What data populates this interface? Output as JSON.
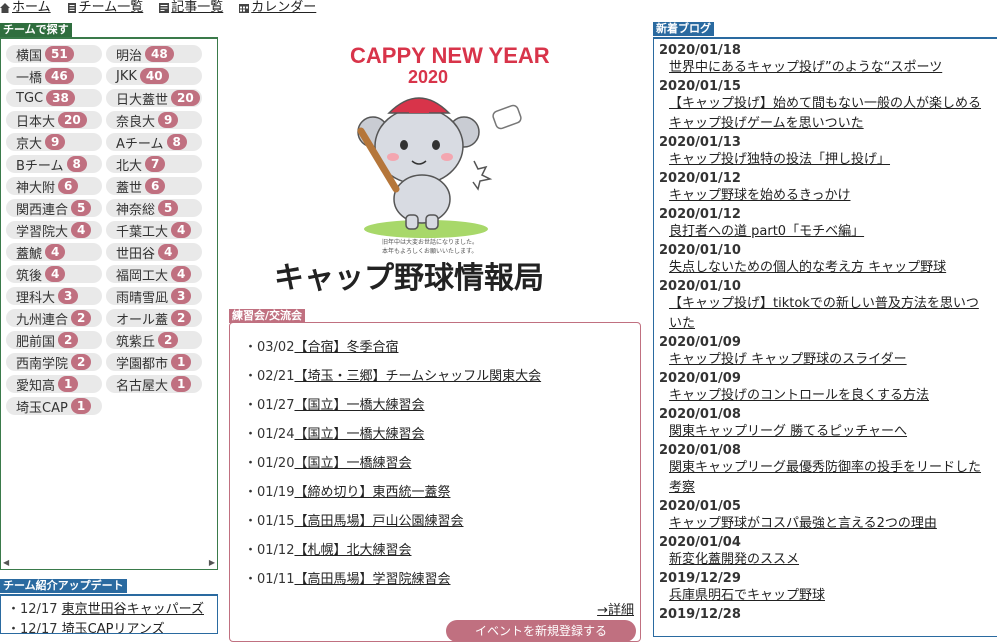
{
  "nav": [
    {
      "label": "ホーム",
      "icon": "home-icon"
    },
    {
      "label": "チーム一覧",
      "icon": "list-icon"
    },
    {
      "label": "記事一覧",
      "icon": "article-icon"
    },
    {
      "label": "カレンダー",
      "icon": "calendar-icon"
    }
  ],
  "team_section": {
    "title": "チームで探す",
    "teams": [
      {
        "name": "横国",
        "count": "51"
      },
      {
        "name": "明治",
        "count": "48"
      },
      {
        "name": "一橋",
        "count": "46"
      },
      {
        "name": "JKK",
        "count": "40"
      },
      {
        "name": "TGC",
        "count": "38"
      },
      {
        "name": "日大蓋世",
        "count": "20"
      },
      {
        "name": "日本大",
        "count": "20"
      },
      {
        "name": "奈良大",
        "count": "9"
      },
      {
        "name": "京大",
        "count": "9"
      },
      {
        "name": "Aチーム",
        "count": "8"
      },
      {
        "name": "Bチーム",
        "count": "8"
      },
      {
        "name": "北大",
        "count": "7"
      },
      {
        "name": "神大附",
        "count": "6"
      },
      {
        "name": "蓋世",
        "count": "6"
      },
      {
        "name": "関西連合",
        "count": "5"
      },
      {
        "name": "神奈総",
        "count": "5"
      },
      {
        "name": "学習院大",
        "count": "4"
      },
      {
        "name": "千葉工大",
        "count": "4"
      },
      {
        "name": "蓋鯱",
        "count": "4"
      },
      {
        "name": "世田谷",
        "count": "4"
      },
      {
        "name": "筑後",
        "count": "4"
      },
      {
        "name": "福岡工大",
        "count": "4"
      },
      {
        "name": "理科大",
        "count": "3"
      },
      {
        "name": "雨晴雪凪",
        "count": "3"
      },
      {
        "name": "九州連合",
        "count": "2"
      },
      {
        "name": "オール蓋",
        "count": "2"
      },
      {
        "name": "肥前国",
        "count": "2"
      },
      {
        "name": "筑紫丘",
        "count": "2"
      },
      {
        "name": "西南学院",
        "count": "2"
      },
      {
        "name": "学園都市",
        "count": "1"
      },
      {
        "name": "愛知高",
        "count": "1"
      },
      {
        "name": "名古屋大",
        "count": "1"
      },
      {
        "name": "埼玉CAP",
        "count": "1"
      }
    ]
  },
  "team_update": {
    "title": "チーム紹介アップデート",
    "items": [
      {
        "date": "12/17",
        "name": "東京世田谷キャッパーズ"
      },
      {
        "date": "12/17",
        "name": "埼玉CAPリアンズ"
      }
    ]
  },
  "banner": {
    "greeting": "CAPPY NEW YEAR",
    "year": "2020",
    "message_line1": "旧年中は大変お世話になりました。",
    "message_line2": "本年もよろしくお願いいたします。",
    "logo": "キャップ野球情報局"
  },
  "practice": {
    "title": "練習会/交流会",
    "items": [
      {
        "date": "03/02",
        "title": "【合宿】冬季合宿"
      },
      {
        "date": "02/21",
        "title": "【埼玉・三郷】チームシャッフル関東大会"
      },
      {
        "date": "01/27",
        "title": "【国立】一橋大練習会"
      },
      {
        "date": "01/24",
        "title": "【国立】一橋大練習会"
      },
      {
        "date": "01/20",
        "title": "【国立】一橋練習会"
      },
      {
        "date": "01/19",
        "title": "【締め切り】東西統一蓋祭"
      },
      {
        "date": "01/15",
        "title": "【高田馬場】戸山公園練習会"
      },
      {
        "date": "01/12",
        "title": "【札幌】北大練習会"
      },
      {
        "date": "01/11",
        "title": "【高田馬場】学習院練習会"
      }
    ],
    "detail_link": "→詳細",
    "button_label": "イベントを新規登録する"
  },
  "blog": {
    "title": "新着ブログ",
    "entries": [
      {
        "date": "2020/01/18",
        "title": "世界中にあるキャップ投げ”のような“スポーツ"
      },
      {
        "date": "2020/01/15",
        "title": "【キャップ投げ】始めて間もない一般の人が楽しめる",
        "title2": "キャップ投げゲームを思いついた"
      },
      {
        "date": "2020/01/13",
        "title": "キャップ投げ独特の投法「押し投げ」"
      },
      {
        "date": "2020/01/12",
        "title": "キャップ野球を始めるきっかけ"
      },
      {
        "date": "2020/01/12",
        "title": "良打者への道 part0「モチベ編」"
      },
      {
        "date": "2020/01/10",
        "title": "失点しないための個人的な考え方 キャップ野球"
      },
      {
        "date": "2020/01/10",
        "title": "【キャップ投げ】tiktokでの新しい普及方法を思いつ",
        "title2": "いた"
      },
      {
        "date": "2020/01/09",
        "title": "キャップ投げ キャップ野球のスライダー"
      },
      {
        "date": "2020/01/09",
        "title": "キャップ投げのコントロールを良くする方法"
      },
      {
        "date": "2020/01/08",
        "title": "関東キャップリーグ 勝てるピッチャーへ"
      },
      {
        "date": "2020/01/08",
        "title": "関東キャップリーグ最優秀防御率の投手をリードした",
        "title2": "考察"
      },
      {
        "date": "2020/01/05",
        "title": "キャップ野球がコスパ最強と言える2つの理由"
      },
      {
        "date": "2020/01/04",
        "title": "新変化蓋開発のススメ"
      },
      {
        "date": "2019/12/29",
        "title": "兵庫県明石でキャップ野球"
      },
      {
        "date": "2019/12/28",
        "title": ""
      }
    ]
  },
  "colors": {
    "green": "#2f6e3e",
    "blue": "#2a6aa0",
    "pink": "#c07080"
  }
}
